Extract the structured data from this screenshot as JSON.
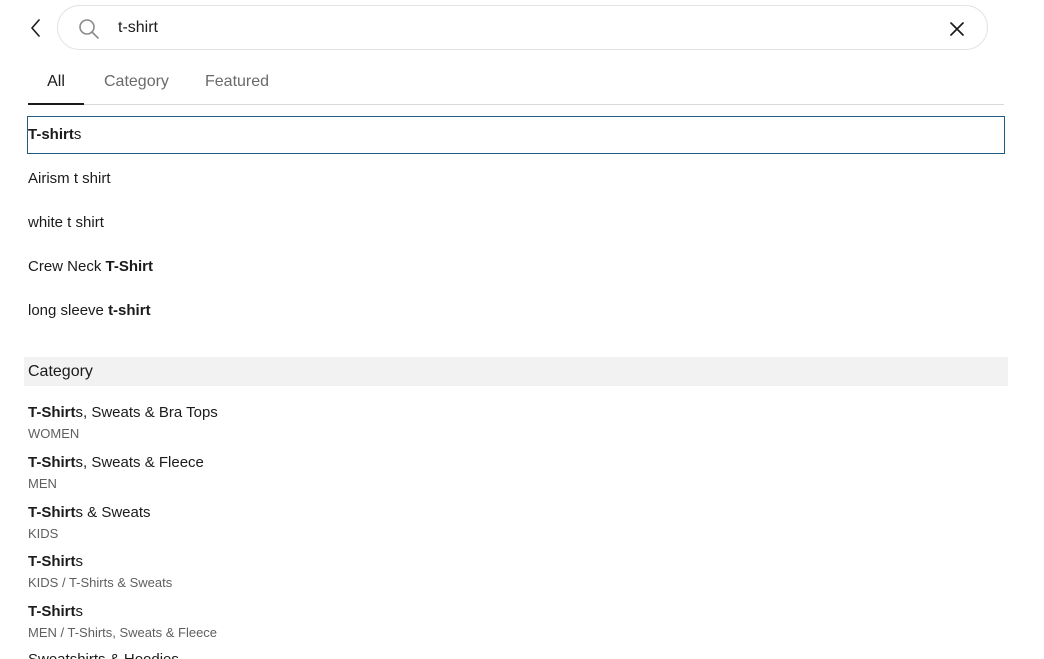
{
  "search": {
    "value": "t-shirt"
  },
  "tabs": [
    {
      "label": "All",
      "active": true
    },
    {
      "label": "Category",
      "active": false
    },
    {
      "label": "Featured",
      "active": false
    }
  ],
  "suggestions": [
    {
      "pre": "",
      "bold": "T-shirt",
      "post": "s"
    },
    {
      "pre": "Airism t shirt",
      "bold": "",
      "post": ""
    },
    {
      "pre": "white t shirt",
      "bold": "",
      "post": ""
    },
    {
      "pre": "Crew Neck ",
      "bold": "T-Shirt",
      "post": ""
    },
    {
      "pre": "long sleeve ",
      "bold": "t-shirt",
      "post": ""
    }
  ],
  "category_section": {
    "header": "Category",
    "items": [
      {
        "bold": "T-Shirt",
        "rest": "s, Sweats & Bra Tops",
        "sub": "WOMEN"
      },
      {
        "bold": "T-Shirt",
        "rest": "s, Sweats & Fleece",
        "sub": "MEN"
      },
      {
        "bold": "T-Shirt",
        "rest": "s & Sweats",
        "sub": "KIDS"
      },
      {
        "bold": "T-Shirt",
        "rest": "s",
        "sub": "KIDS / T-Shirts & Sweats"
      },
      {
        "bold": "T-Shirt",
        "rest": "s",
        "sub": "MEN / T-Shirts, Sweats & Fleece"
      },
      {
        "bold": "",
        "rest": "Sweatshirts & Hoodies",
        "sub": ""
      }
    ]
  }
}
